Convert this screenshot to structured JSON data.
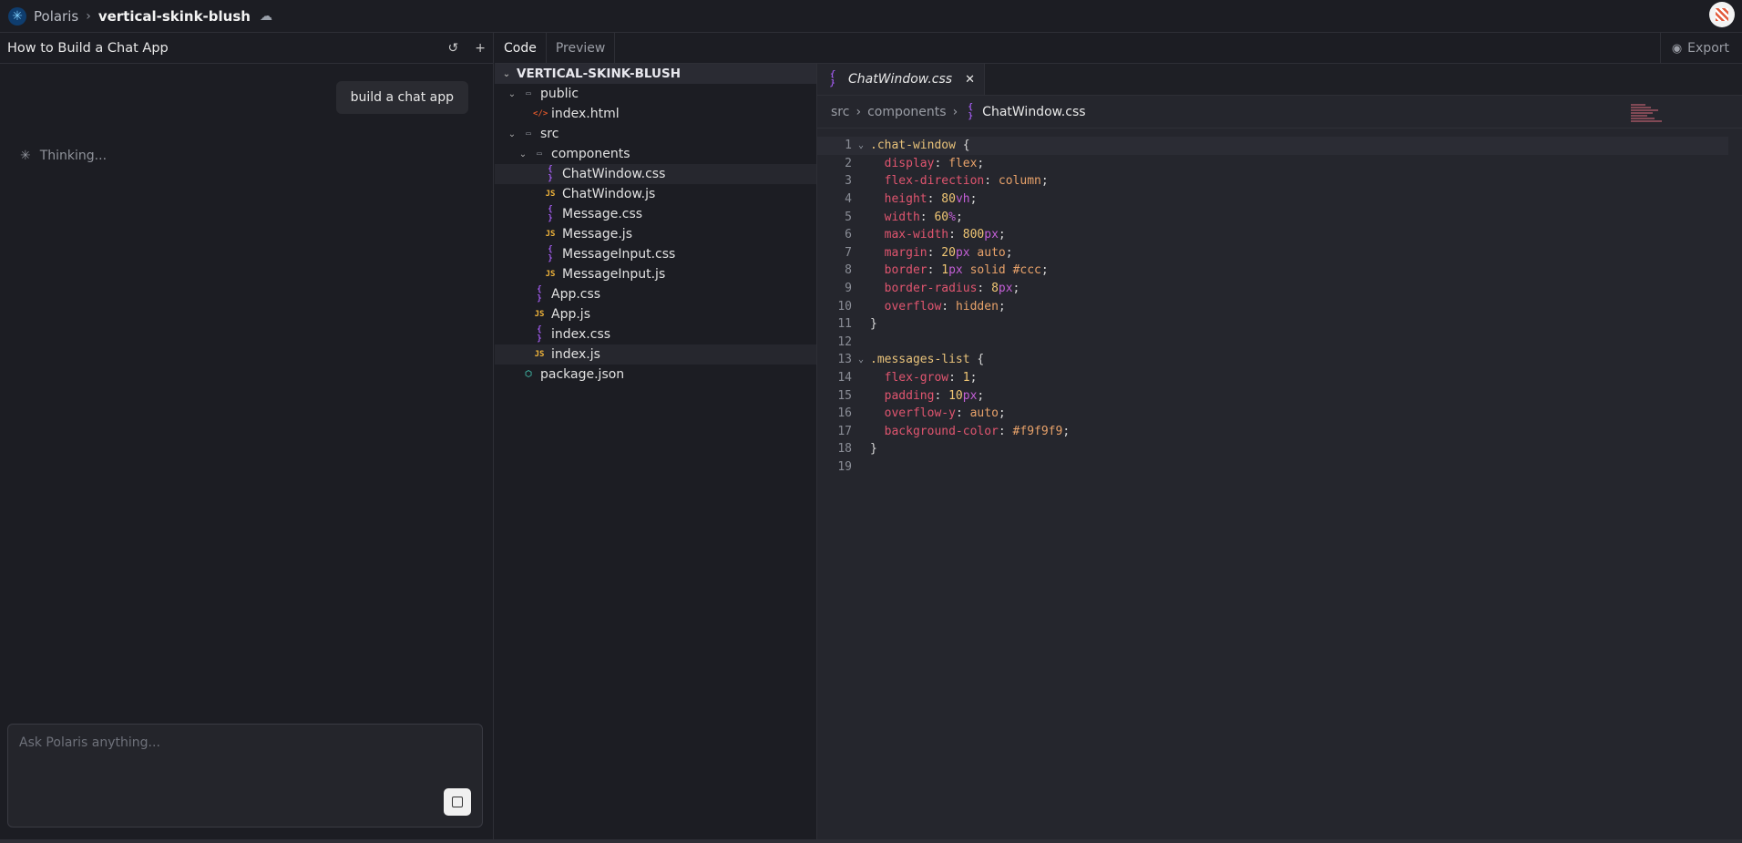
{
  "topbar": {
    "brand": "Polaris",
    "project": "vertical-skink-blush"
  },
  "chat": {
    "title": "How to Build a Chat App",
    "user_message": "build a chat app",
    "status": "Thinking...",
    "input_placeholder": "Ask Polaris anything..."
  },
  "tabs": {
    "code": "Code",
    "preview": "Preview",
    "export": "Export"
  },
  "tree": {
    "root": "VERTICAL-SKINK-BLUSH",
    "items": [
      {
        "label": "public",
        "type": "folder",
        "depth": 1
      },
      {
        "label": "index.html",
        "type": "html",
        "depth": 2
      },
      {
        "label": "src",
        "type": "folder",
        "depth": 1
      },
      {
        "label": "components",
        "type": "folder",
        "depth": 2
      },
      {
        "label": "ChatWindow.css",
        "type": "css",
        "depth": 3
      },
      {
        "label": "ChatWindow.js",
        "type": "js",
        "depth": 3
      },
      {
        "label": "Message.css",
        "type": "css",
        "depth": 3
      },
      {
        "label": "Message.js",
        "type": "js",
        "depth": 3
      },
      {
        "label": "MessageInput.css",
        "type": "css",
        "depth": 3
      },
      {
        "label": "MessageInput.js",
        "type": "js",
        "depth": 3
      },
      {
        "label": "App.css",
        "type": "css",
        "depth": 2
      },
      {
        "label": "App.js",
        "type": "js",
        "depth": 2
      },
      {
        "label": "index.css",
        "type": "css",
        "depth": 2
      },
      {
        "label": "index.js",
        "type": "js",
        "depth": 2
      },
      {
        "label": "package.json",
        "type": "json",
        "depth": 1
      }
    ]
  },
  "editor": {
    "tab": "ChatWindow.css",
    "breadcrumb": [
      "src",
      "components",
      "ChatWindow.css"
    ],
    "lines": [
      ".chat-window {",
      "  display: flex;",
      "  flex-direction: column;",
      "  height: 80vh;",
      "  width: 60%;",
      "  max-width: 800px;",
      "  margin: 20px auto;",
      "  border: 1px solid #ccc;",
      "  border-radius: 8px;",
      "  overflow: hidden;",
      "}",
      "",
      ".messages-list {",
      "  flex-grow: 1;",
      "  padding: 10px;",
      "  overflow-y: auto;",
      "  background-color: #f9f9f9;",
      "}",
      ""
    ]
  },
  "icons": {
    "logo": "sparkle-logo-icon",
    "cloud": "cloud-sync-icon",
    "history": "history-icon",
    "add": "plus-icon",
    "github": "github-icon",
    "spinner": "spinner-icon",
    "send": "stop-square-icon"
  }
}
